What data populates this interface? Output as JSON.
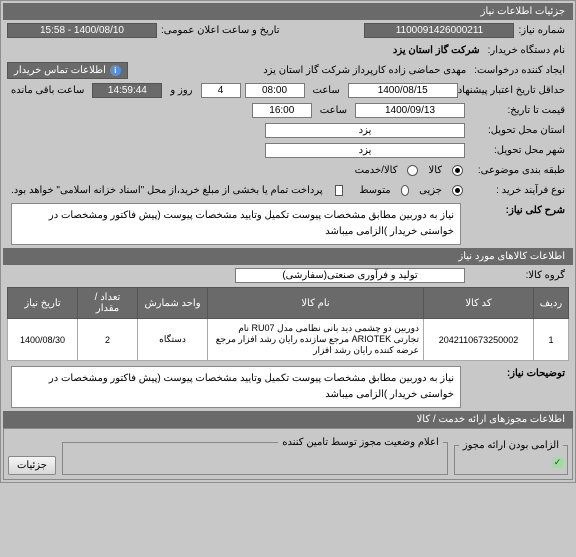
{
  "header": {
    "title": "جزئیات اطلاعات نیاز"
  },
  "need": {
    "number_label": "شماره نیاز:",
    "number": "1100091426000211",
    "datetime_label": "تاریخ و ساعت اعلان عمومی:",
    "datetime": "1400/08/10 - 15:58",
    "buyer_label": "نام دستگاه خریدار:",
    "buyer": "شرکت گاز استان یزد",
    "creator_label": "ایجاد کننده درخواست:",
    "creator": "مهدی حماضی زاده کارپرداز شرکت گاز استان یزد",
    "contact_btn": "اطلاعات تماس خریدار",
    "deadline_label": "حداقل تاریخ اعتبار پیشنهاد:",
    "deadline_date": "1400/08/15",
    "deadline_time_label1": "ساعت",
    "deadline_time": "08:00",
    "days_label": "روز و",
    "days": "4",
    "remain_time": "14:59:44",
    "remain_label": "ساعت باقی مانده",
    "quote_until_label": "قیمت تا تاریخ:",
    "quote_date": "1400/09/13",
    "quote_time_label": "ساعت",
    "quote_time": "16:00",
    "province_label": "استان محل تحویل:",
    "province": "یزد",
    "city_label": "شهر محل تحویل:",
    "city": "یزد",
    "category_label": "طبقه بندی موضوعی:",
    "cat1": "کالا",
    "cat2": "کالا/خدمت",
    "purchase_type_label": "نوع فرآیند خرید :",
    "pt1": "جزیی",
    "pt2": "متوسط",
    "payment_cb_label": "پرداخت تمام یا بخشی از مبلغ خرید،از محل \"اسناد خزانه اسلامی\" خواهد بود.",
    "summary_label": "شرح کلی نیاز:",
    "summary": "نیاز به دوربین مطابق مشخصات پیوست تکمیل وتایید مشخصات پیوست (پیش فاکتور ومشخصات در خواستی خریدار )الزامی میباشد"
  },
  "items": {
    "header": "اطلاعات کالاهای مورد نیاز",
    "group_label": "گروه کالا:",
    "group": "تولید و فرآوری صنعتی(سفارشی)",
    "columns": {
      "row": "ردیف",
      "code": "کد کالا",
      "name": "نام کالا",
      "unit": "واحد شمارش",
      "qty": "تعداد / مقدار",
      "date": "تاریخ نیاز"
    },
    "rows": [
      {
        "row": "1",
        "code": "2042110673250002",
        "name": "دوربین دو چشمی دید بانی نظامی مدل RU07 نام تجارتی ARIOTEK مرجع سازنده رایان رشد افزار مرجع عرضه کننده رایان رشد افزار",
        "unit": "دستگاه",
        "qty": "2",
        "date": "1400/08/30"
      }
    ],
    "notes_label": "توضیحات نیاز:",
    "notes": "نیاز به دوربین مطابق مشخصات پیوست تکمیل وتایید مشخصات پیوست (پیش فاکتور ومشخصات در خواستی خریدار )الزامی میباشد"
  },
  "licenses": {
    "header": "اطلاعات مجوزهای ارائه خدمت / کالا"
  },
  "footer": {
    "provider_status_legend": "اعلام وضعیت مجوز توسط تامین کننده",
    "provider_required": "الزامی بودن ارائه مجوز",
    "details": "جزئیات"
  }
}
